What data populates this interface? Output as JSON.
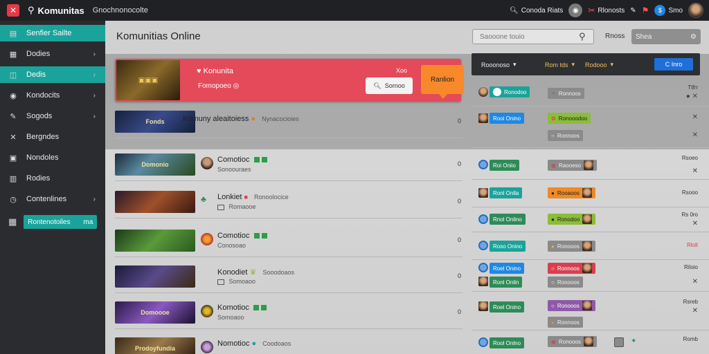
{
  "topbar": {
    "brand": "Komunitas",
    "nav": "Gnochnonocolte",
    "search_label": "Conoda Riats",
    "notif_label": "Rlonosts",
    "count_label": "Smo",
    "colors": {
      "bar": "#1f2124",
      "logo": "#e53945"
    }
  },
  "sidebar": {
    "items": [
      {
        "label": "Senfier Sailte",
        "icon": "layers-icon",
        "active": true
      },
      {
        "label": "Dodies",
        "icon": "grid-icon",
        "chevron": true
      },
      {
        "label": "Dedis",
        "icon": "controller-icon",
        "active": true,
        "chevron": true
      },
      {
        "label": "Kondocits",
        "icon": "target-icon",
        "chevron": true
      },
      {
        "label": "Sogods",
        "icon": "wrench-icon",
        "chevron": true
      },
      {
        "label": "Bergndes",
        "icon": "tools-icon"
      },
      {
        "label": "Nondoles",
        "icon": "square-icon"
      },
      {
        "label": "Rodies",
        "icon": "bag-icon"
      },
      {
        "label": "Contenlines",
        "icon": "clock-icon",
        "chevron": true
      }
    ],
    "bottom_pill": {
      "label": "Rontenotoiles",
      "value": "ma"
    },
    "accent": "#1aa39a"
  },
  "main": {
    "title": "Komunitias Online",
    "search_placeholder": "Saooone touio",
    "search_side_label": "Rnoss",
    "filter_label": "Shea"
  },
  "feature": {
    "title": "Konunita",
    "subtitle": "Fomopoeo",
    "count": "Xoo",
    "button": "Sornoo",
    "cta": "Ranlion",
    "colors": {
      "banner": "#e44a5a",
      "cta": "#f7892b"
    }
  },
  "games": [
    {
      "title": "Komuny aleaitoiess",
      "tag": "Nynacocioies",
      "num": "0",
      "thumb": "Fonds"
    },
    {
      "title": "Comotioc",
      "sub": "Sonoouraes",
      "num": "0",
      "thumb": "Domonio"
    },
    {
      "title": "Lonkiet",
      "tag": "Ronoolocice",
      "sub": "Romaooe",
      "num": "0",
      "thumb": ""
    },
    {
      "title": "Comotioc",
      "sub": "Conosoao",
      "num": "0",
      "thumb": ""
    },
    {
      "title": "Konodiet",
      "tag": "Sooodoaos",
      "sub": "Somoaoo",
      "num": "0",
      "thumb": ""
    },
    {
      "title": "Komotioc",
      "sub": "Somoaoo",
      "num": "0",
      "thumb": "Domoooe"
    },
    {
      "title": "Nomotioc",
      "tag": "Coodoaos",
      "num": "",
      "thumb": "Prodoyfundia"
    }
  ],
  "right_panel": {
    "headers": [
      "Rooonoso",
      "Rom tds",
      "Rodooo",
      "C Inro"
    ],
    "rows": [
      {
        "chip1": "Ronodoo",
        "chip2": "Ronnoos",
        "val": "Ttfrr"
      },
      {
        "chip1": "Rooi Onino",
        "chip2": "Ronooodoo",
        "chip3": "Ronnoos"
      },
      {
        "chip1": "Roi Oniio",
        "chip2": "Raooeso",
        "val": "Rsoeo"
      },
      {
        "chip1": "Ronl Onlla",
        "chip2": "Rooaoos",
        "val": "Rsooo"
      },
      {
        "chip1": "Rnol Onlino",
        "chip2": "Ronodoo",
        "val": "Rs 0ro"
      },
      {
        "chip1": "Roso Onino",
        "chip2": "Ronooos",
        "val": "Rlolt"
      },
      {
        "chip1": "Roel Onino",
        "chip1b": "Ronl Onlin",
        "chip2": "Ronnoos",
        "chip2b": "Ronooos",
        "val": "Riloio"
      },
      {
        "chip1": "Roel Onino",
        "chip2": "Ronooos",
        "chip2b": "Ronnoos",
        "val": "Rsreb"
      },
      {
        "chip1": "Rool Onlno",
        "chip2": "Ronooos",
        "val": "Romb"
      }
    ]
  }
}
